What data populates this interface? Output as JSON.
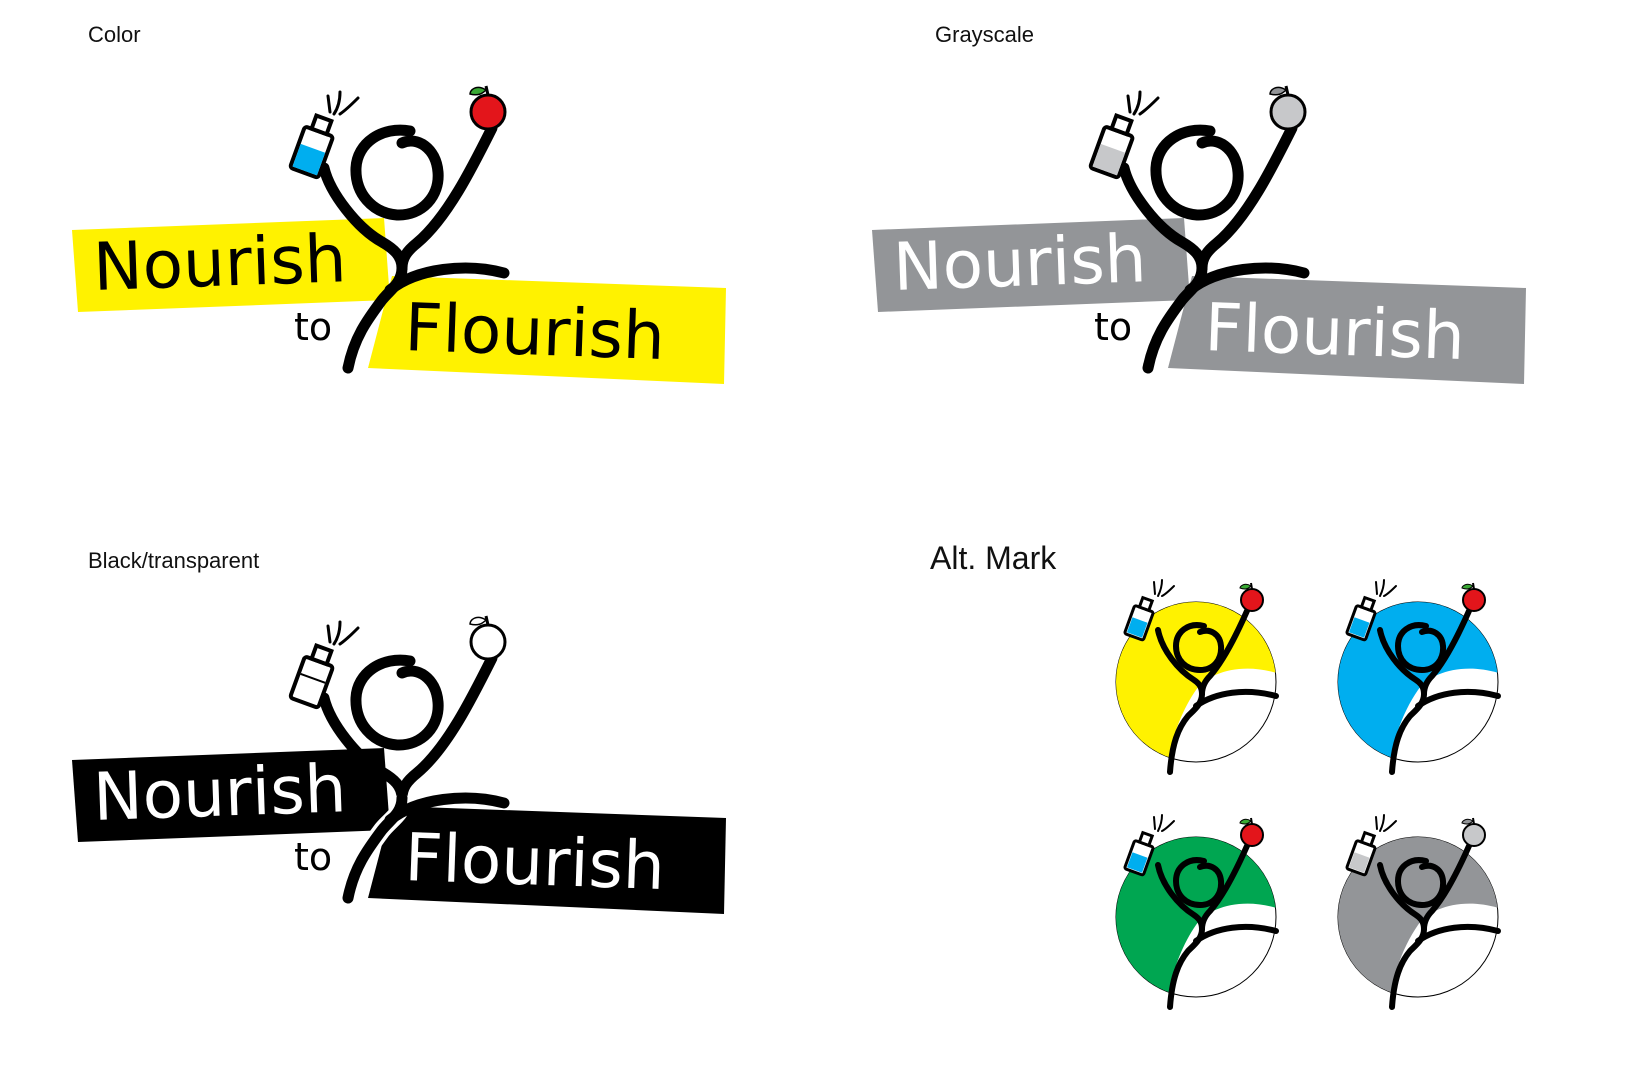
{
  "colors": {
    "yellow": "#fff200",
    "gray": "#939598",
    "black": "#000000",
    "white": "#ffffff",
    "blue": "#00aeef",
    "green": "#00a651",
    "apple_red": "#e3151b",
    "leaf_green": "#3aa935",
    "light_gray": "#c7c8ca"
  },
  "sections": {
    "color": {
      "label": "Color"
    },
    "grayscale": {
      "label": "Grayscale"
    },
    "black": {
      "label": "Black/transparent"
    },
    "alt": {
      "label": "Alt. Mark"
    }
  },
  "logo_text": {
    "line1": "Nourish",
    "connector": "to",
    "line2": "Flourish"
  },
  "alt_marks": [
    {
      "name": "yellow",
      "fill_color": "#fff200"
    },
    {
      "name": "blue",
      "fill_color": "#00aeef"
    },
    {
      "name": "green",
      "fill_color": "#00a651"
    },
    {
      "name": "gray",
      "fill_color": "#939598"
    }
  ]
}
